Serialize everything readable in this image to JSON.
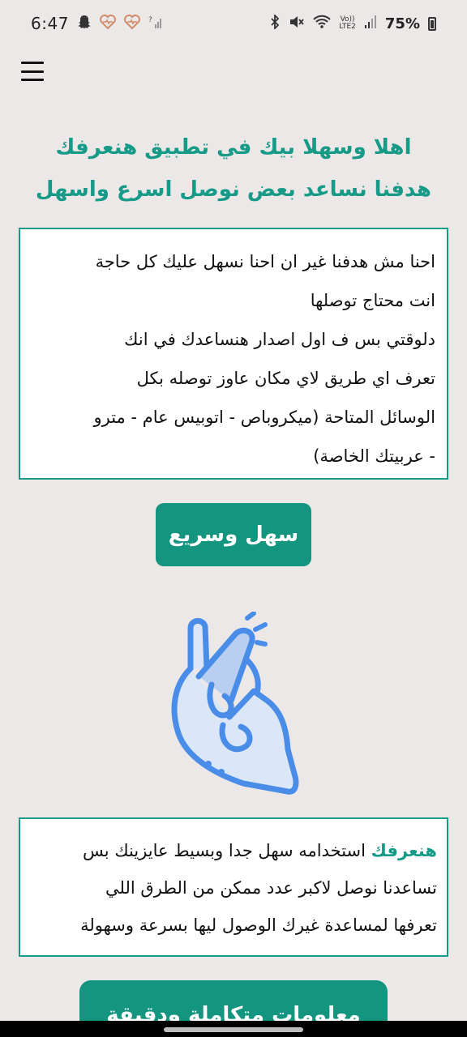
{
  "status_bar": {
    "time": "6:47",
    "battery": "75%",
    "icons_left": [
      "snapchat-icon",
      "heart-health-icon",
      "heart-health-icon",
      "signal-question-icon"
    ],
    "icons_right": [
      "bluetooth-icon",
      "mute-icon",
      "wifi-icon",
      "volte-icon",
      "signal-icon",
      "battery-icon"
    ],
    "lte_top": "Vo))",
    "lte_bottom": "LTE2"
  },
  "header": {
    "menu_icon": "hamburger-menu-icon"
  },
  "intro": {
    "line1": "اهلا وسهلا بيك في تطبيق هنعرفك",
    "line2": "هدفنا نساعد بعض نوصل اسرع واسهل"
  },
  "about_card": {
    "line1": "احنا مش هدفنا غير ان احنا نسهل عليك كل حاجة",
    "line2": "انت محتاج توصلها",
    "line3": "دلوقتي بس ف اول اصدار هنساعدك في انك",
    "line4": "تعرف اي طريق لاي مكان عاوز توصله بكل",
    "line5": "الوسائل المتاحة (ميكروباص - اتوبيس عام - مترو",
    "line6": "- عربيتك الخاصة)"
  },
  "easy_button": {
    "label": "سهل وسريع"
  },
  "illustration": {
    "icon": "fingers-snap-icon",
    "stroke_color": "#4a8de8",
    "fill_color": "#dbe6f7"
  },
  "usage_card": {
    "brand": "هنعرفك",
    "line1_rest": " استخدامه سهل جدا وبسيط عايزينك بس",
    "line2": "تساعدنا نوصل لاكبر عدد ممكن من الطرق اللي",
    "line3": "تعرفها لمساعدة غيرك الوصول ليها بسرعة وسهولة"
  },
  "info_button": {
    "label": "معلومات متكاملة ودقيقة"
  },
  "colors": {
    "accent": "#179a88",
    "button": "#139580",
    "background": "#ebe8e7"
  }
}
